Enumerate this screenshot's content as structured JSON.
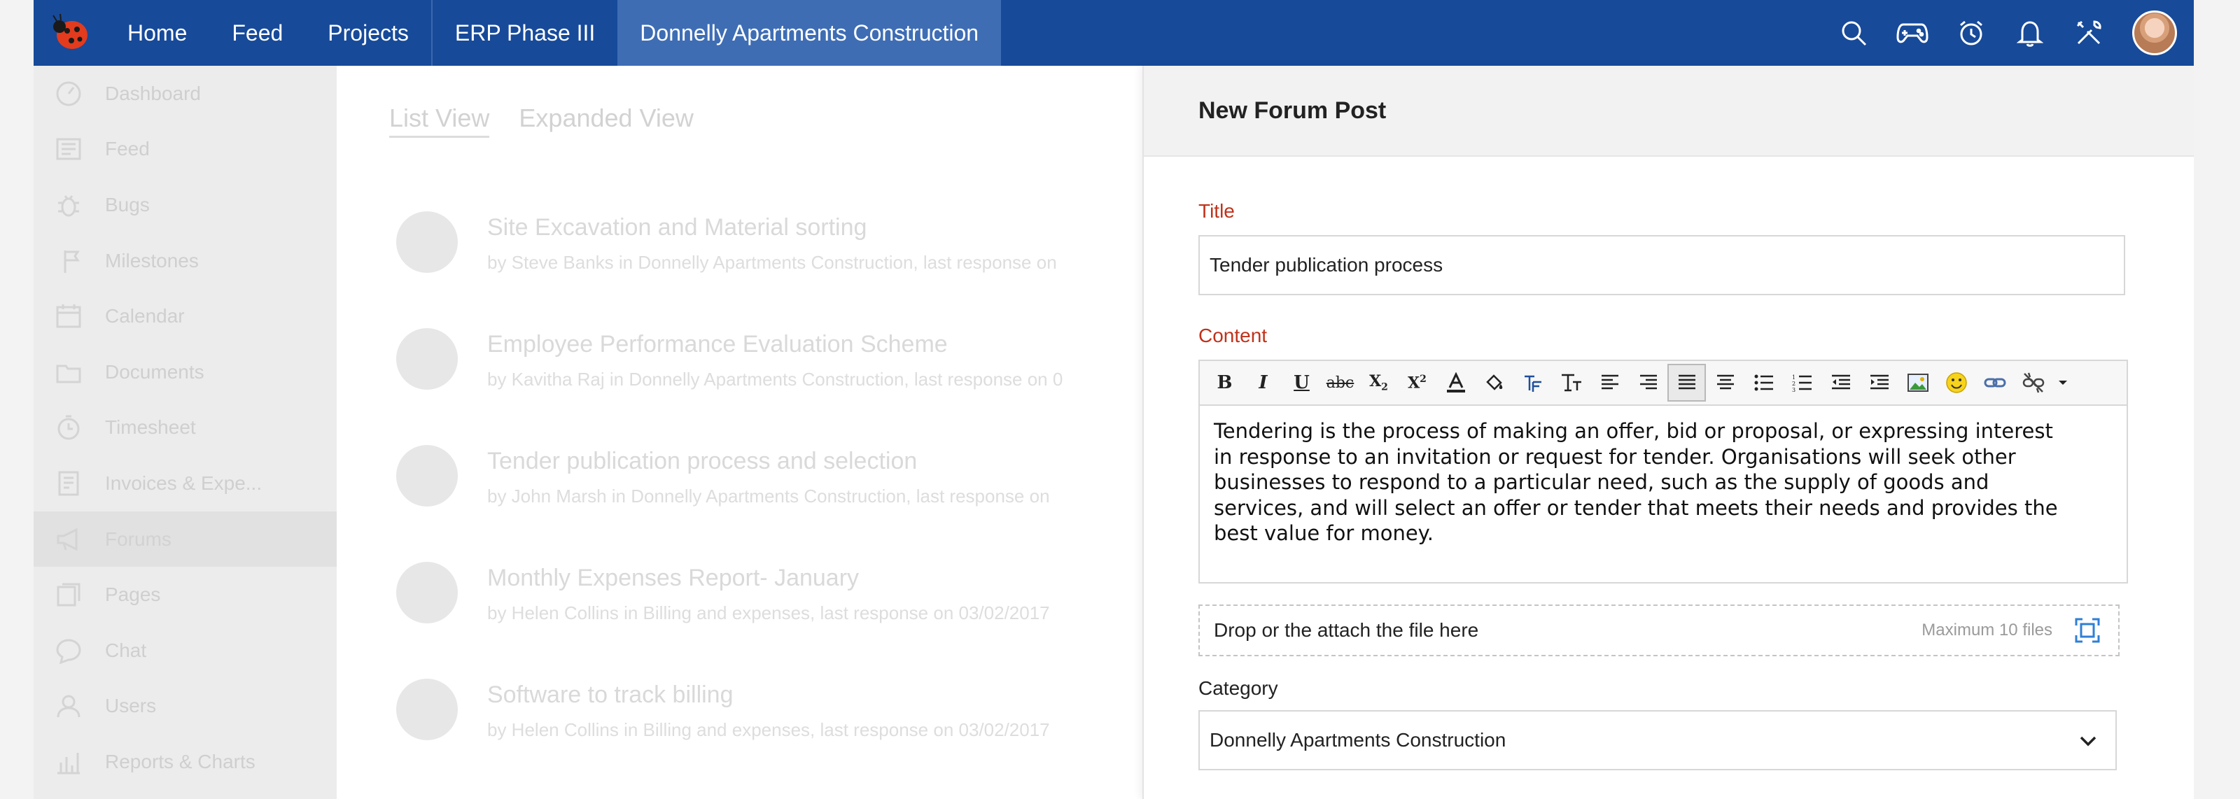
{
  "nav": {
    "items": [
      {
        "label": "Home"
      },
      {
        "label": "Feed"
      },
      {
        "label": "Projects"
      },
      {
        "label": "ERP Phase III"
      },
      {
        "label": "Donnelly Apartments Construction"
      }
    ],
    "icons": [
      "search-icon",
      "gamepad-icon",
      "alarm-clock-icon",
      "bell-icon",
      "tools-icon"
    ]
  },
  "sidebar": {
    "items": [
      {
        "label": "Dashboard",
        "icon": "dashboard-icon"
      },
      {
        "label": "Feed",
        "icon": "feed-icon"
      },
      {
        "label": "Bugs",
        "icon": "bug-icon"
      },
      {
        "label": "Milestones",
        "icon": "milestone-icon"
      },
      {
        "label": "Calendar",
        "icon": "calendar-icon"
      },
      {
        "label": "Documents",
        "icon": "documents-icon"
      },
      {
        "label": "Timesheet",
        "icon": "timesheet-icon"
      },
      {
        "label": "Invoices & Expe...",
        "icon": "invoice-icon"
      },
      {
        "label": "Forums",
        "icon": "megaphone-icon"
      },
      {
        "label": "Pages",
        "icon": "pages-icon"
      },
      {
        "label": "Chat",
        "icon": "chat-icon"
      },
      {
        "label": "Users",
        "icon": "users-icon"
      },
      {
        "label": "Reports & Charts",
        "icon": "reports-icon"
      }
    ],
    "active": "Forums"
  },
  "main": {
    "tabs": [
      {
        "label": "List View"
      },
      {
        "label": "Expanded View"
      }
    ],
    "posts": [
      {
        "title": "Site Excavation and Material sorting",
        "meta": "by Steve Banks in Donnelly Apartments Construction,  last response on"
      },
      {
        "title": "Employee Performance Evaluation Scheme",
        "meta": "by Kavitha Raj in Donnelly Apartments Construction,  last response on 0"
      },
      {
        "title": "Tender publication process and selection",
        "meta": "by John Marsh in Donnelly Apartments Construction,  last response on"
      },
      {
        "title": "Monthly Expenses Report- January",
        "meta": "by Helen Collins in Billing and expenses,  last response on 03/02/2017"
      },
      {
        "title": "Software to track billing",
        "meta": "by Helen Collins in Billing and expenses,  last response on 03/02/2017"
      }
    ]
  },
  "panel": {
    "title": "New Forum Post",
    "title_label": "Title",
    "title_value": "Tender publication process",
    "content_label": "Content",
    "content_lines": [
      "Tendering is the process of making an offer, bid or proposal, or expressing interest",
      "in response to an invitation or request for tender. Organisations will seek other",
      "businesses to respond to a particular need, such as the supply of goods and",
      "services, and will select an offer or tender that meets their needs and provides the",
      "best value for money."
    ],
    "drop_text": "Drop or the attach the file here",
    "drop_max": "Maximum 10 files",
    "category_label": "Category",
    "category_value": "Donnelly Apartments Construction"
  },
  "colors": {
    "nav_bg": "#174a99",
    "nav_active": "#3e6db4",
    "label_red": "#c0321b"
  }
}
